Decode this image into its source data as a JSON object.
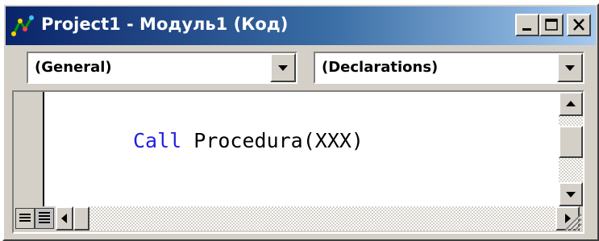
{
  "window": {
    "title": "Project1 - Модуль1 (Код)",
    "icons": {
      "app": "vb-project-icon",
      "minimize": "minimize-icon",
      "maximize": "maximize-icon",
      "close": "close-icon"
    }
  },
  "toolbar": {
    "object_combo": {
      "value": "(General)",
      "icon": "chevron-down-icon"
    },
    "procedure_combo": {
      "value": "(Declarations)",
      "icon": "chevron-down-icon"
    }
  },
  "editor": {
    "code_lines": [
      {
        "keyword": "Call",
        "text": " Procedura(XXX)"
      }
    ],
    "colors": {
      "keyword": "#1f1fe0",
      "text": "#000000",
      "titlebar_start": "#0a246a",
      "titlebar_end": "#a6caf0"
    }
  },
  "statusbar": {
    "icons": {
      "procedure_view": "procedure-view-icon",
      "full_module_view": "full-module-view-icon",
      "resize_grip": "resize-grip-icon"
    }
  }
}
